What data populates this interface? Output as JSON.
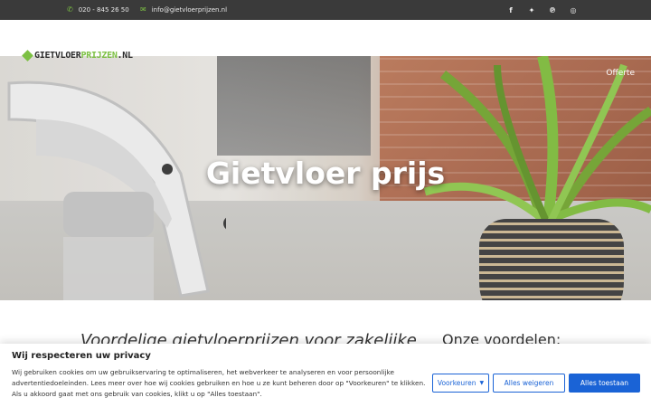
{
  "topbar": {
    "phone_icon": "phone-icon",
    "phone": "020 - 845 26 50",
    "email_icon": "envelope-icon",
    "email": "info@gietvloerprijzen.nl",
    "social": [
      {
        "icon": "facebook-icon",
        "glyph": "f"
      },
      {
        "icon": "twitter-icon",
        "glyph": "🐦"
      },
      {
        "icon": "pinterest-icon",
        "glyph": "℗"
      },
      {
        "icon": "instagram-icon",
        "glyph": "◎"
      }
    ]
  },
  "logo": {
    "part1": "GIETVLOER",
    "part2": "PRIJZEN",
    "part3": ".NL"
  },
  "nav": {
    "offerte": "Offerte"
  },
  "hero": {
    "title": "Gietvloer prijs"
  },
  "content": {
    "heading_left": "Voordelige gietvloerprijzen voor zakelijke",
    "heading_right": "Onze voordelen:"
  },
  "cookie": {
    "title": "Wij respecteren uw privacy",
    "text": "Wij gebruiken cookies om uw gebruikservaring te optimaliseren, het webverkeer te analyseren en voor persoonlijke advertentiedoeleinden. Lees meer over hoe wij cookies gebruiken en hoe u ze kunt beheren door op \"Voorkeuren\" te klikken. Als u akkoord gaat met ons gebruik van cookies, klikt u op \"Alles toestaan\".",
    "preferences": "Voorkeuren",
    "deny": "Alles weigeren",
    "allow": "Alles toestaan"
  },
  "colors": {
    "accent": "#7cc043",
    "topbar": "#3a3a3a",
    "button_blue": "#1a63d6"
  }
}
